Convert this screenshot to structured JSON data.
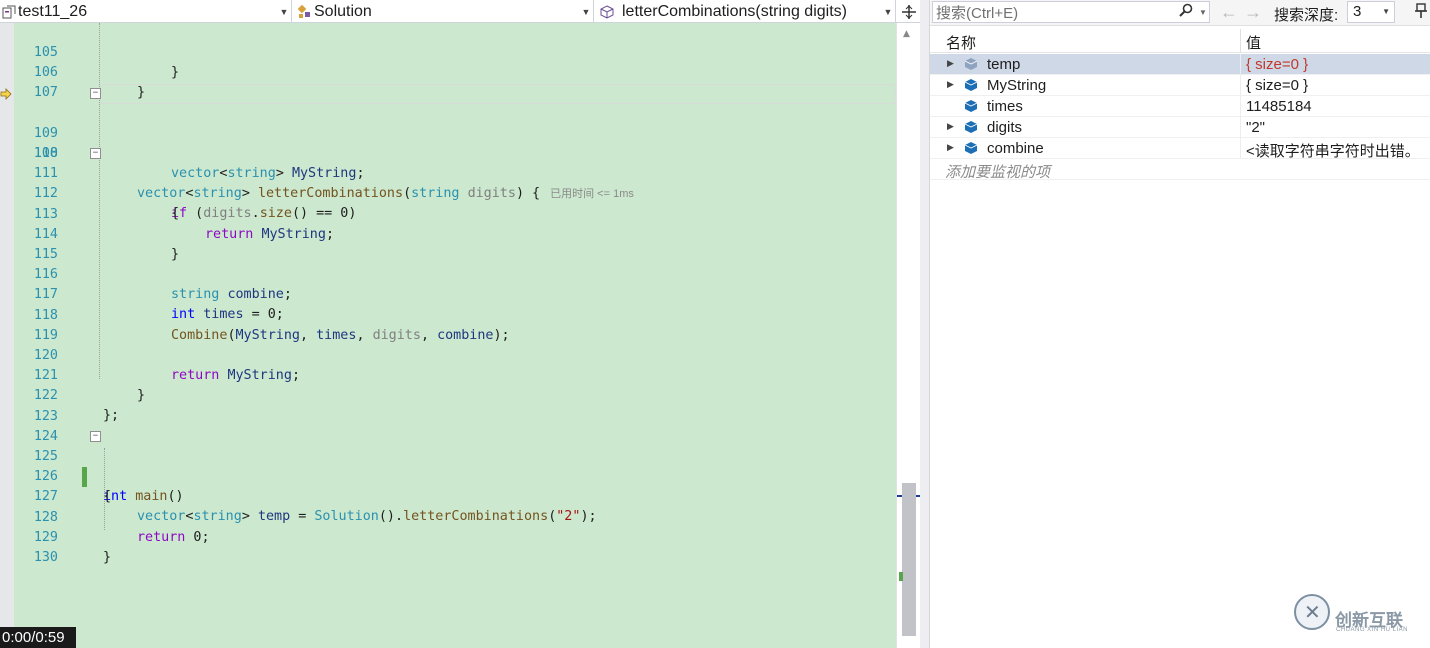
{
  "navbar": {
    "project": "test11_26",
    "class": "Solution",
    "member": "letterCombinations(string digits)"
  },
  "editor": {
    "perf_tip": "已用时间 <= 1ms",
    "lines": [
      {
        "n": "105"
      },
      {
        "n": "106"
      },
      {
        "n": "107"
      },
      {
        "n": "108"
      },
      {
        "n": "109"
      },
      {
        "n": "110"
      },
      {
        "n": "111"
      },
      {
        "n": "112"
      },
      {
        "n": "113"
      },
      {
        "n": "114"
      },
      {
        "n": "115"
      },
      {
        "n": "116"
      },
      {
        "n": "117"
      },
      {
        "n": "118"
      },
      {
        "n": "119"
      },
      {
        "n": "120"
      },
      {
        "n": "121"
      },
      {
        "n": "122"
      },
      {
        "n": "123"
      },
      {
        "n": "124"
      },
      {
        "n": "125"
      },
      {
        "n": "126"
      },
      {
        "n": "127"
      },
      {
        "n": "128"
      },
      {
        "n": "129"
      },
      {
        "n": "130"
      }
    ],
    "code": {
      "l105": "}",
      "l106": "}",
      "l108_type": "vector",
      "l108_t1": "<",
      "l108_targ": "string",
      "l108_t2": "> ",
      "l108_fn": "letterCombinations",
      "l108_t3": "(",
      "l108_ptype": "string",
      "l108_sp": " ",
      "l108_param": "digits",
      "l108_t4": ") {",
      "l110_type": "vector",
      "l110_t1": "<",
      "l110_targ": "string",
      "l110_t2": "> ",
      "l110_var": "MyString",
      "l110_t3": ";",
      "l111_kw": "if",
      "l111_t1": " (",
      "l111_param": "digits",
      "l111_t2": ".",
      "l111_fn": "size",
      "l111_t3": "() == 0)",
      "l112": "{",
      "l113_kw": "return",
      "l113_sp": " ",
      "l113_var": "MyString",
      "l113_t1": ";",
      "l114": "}",
      "l116_type": "string",
      "l116_sp": " ",
      "l116_var": "combine",
      "l116_t1": ";",
      "l117_kw": "int",
      "l117_sp": " ",
      "l117_var": "times",
      "l117_t1": " = 0;",
      "l118_fn": "Combine",
      "l118_t1": "(",
      "l118_v1": "MyString",
      "l118_t2": ", ",
      "l118_v2": "times",
      "l118_t3": ", ",
      "l118_p1": "digits",
      "l118_t4": ", ",
      "l118_v3": "combine",
      "l118_t5": ");",
      "l120_kw": "return",
      "l120_sp": " ",
      "l120_var": "MyString",
      "l120_t1": ";",
      "l121": "}",
      "l122": "};",
      "l125_kw": "int",
      "l125_sp": " ",
      "l125_fn": "main",
      "l125_t1": "()",
      "l126": "{",
      "l127_type": "vector",
      "l127_t1": "<",
      "l127_targ": "string",
      "l127_t2": "> ",
      "l127_var": "temp",
      "l127_t3": " = ",
      "l127_cls": "Solution",
      "l127_t4": "().",
      "l127_fn": "letterCombinations",
      "l127_t5": "(",
      "l127_str": "\"2\"",
      "l127_t6": ");",
      "l128_kw": "return",
      "l128_t1": " 0;",
      "l129": "}"
    }
  },
  "video": {
    "time": "0:00/0:59"
  },
  "watch": {
    "search_placeholder": "搜索(Ctrl+E)",
    "depth_label": "搜索深度:",
    "depth_value": "3",
    "col_name": "名称",
    "col_value": "值",
    "rows": [
      {
        "name": "temp",
        "value": "{ size=0 }"
      },
      {
        "name": "MyString",
        "value": "{ size=0 }"
      },
      {
        "name": "times",
        "value": "11485184"
      },
      {
        "name": "digits",
        "value": "\"2\""
      },
      {
        "name": "combine",
        "value": "<读取字符串字符时出错。"
      }
    ],
    "add_placeholder": "添加要监视的项"
  },
  "watermark": {
    "text": "创新互联",
    "sub": "CHUANG XIN HU LIAN"
  },
  "colors": {
    "editor_bg": "#cce8cf",
    "line_number": "#2b91af",
    "keyword": "#0000ff",
    "type": "#2b91af",
    "function": "#74531f",
    "changed_value": "#c0392b",
    "selected_row": "#cfd8e6"
  }
}
